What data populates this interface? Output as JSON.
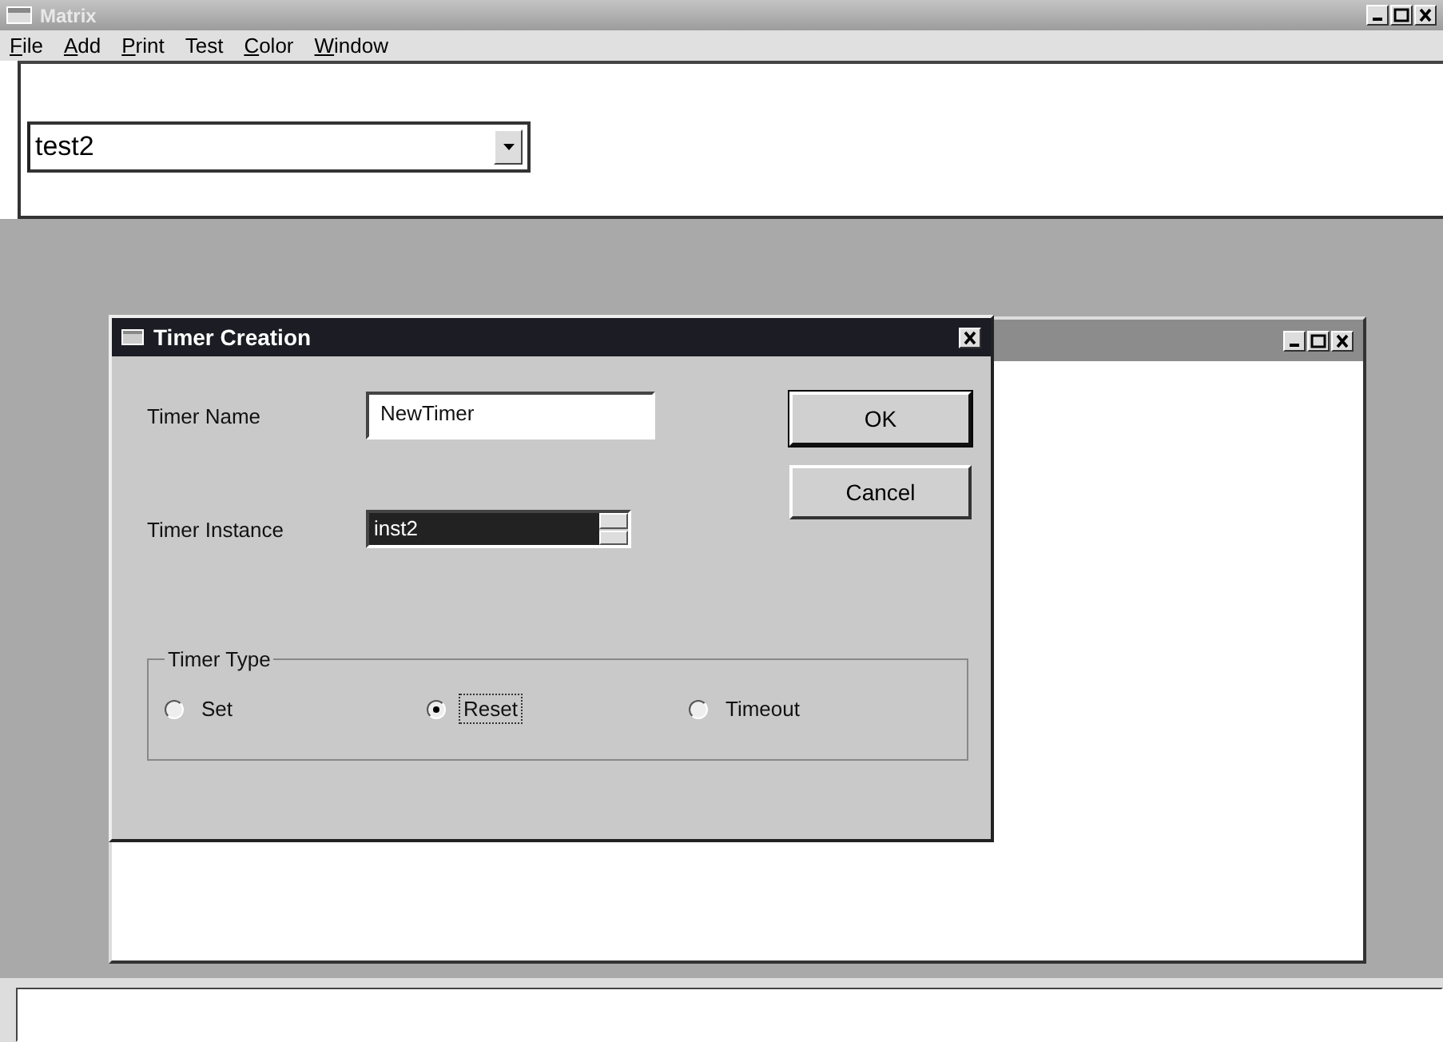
{
  "window": {
    "title": "Matrix",
    "active": false
  },
  "menu": [
    {
      "label": "File",
      "underline": true
    },
    {
      "label": "Add",
      "underline": true
    },
    {
      "label": "Print",
      "underline": true
    },
    {
      "label": "Test",
      "underline": false
    },
    {
      "label": "Color",
      "underline": true
    },
    {
      "label": "Window",
      "underline": true
    }
  ],
  "toolbar": {
    "combo_value": "test2"
  },
  "child_window": {
    "active": false
  },
  "dialog": {
    "title": "Timer Creation",
    "active": true,
    "fields": [
      {
        "kind": "text",
        "label": "Timer Name",
        "value": "NewTimer",
        "highlighted": false
      },
      {
        "kind": "spin",
        "label": "Timer Instance",
        "value": "inst2",
        "highlighted": true
      }
    ],
    "buttons": [
      {
        "label": "OK",
        "default": true
      },
      {
        "label": "Cancel",
        "default": false
      }
    ],
    "group": {
      "title": "Timer Type",
      "options": [
        {
          "label": "Set",
          "selected": false,
          "focused": false
        },
        {
          "label": "Reset",
          "selected": true,
          "focused": true
        },
        {
          "label": "Timeout",
          "selected": false,
          "focused": false
        }
      ]
    }
  }
}
